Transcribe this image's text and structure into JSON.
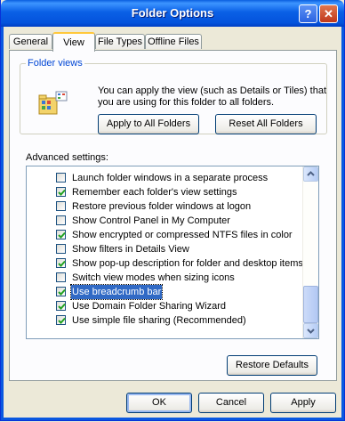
{
  "window": {
    "title": "Folder Options",
    "help_glyph": "?",
    "close_glyph": "✕"
  },
  "tabs": [
    {
      "label": "General",
      "active": false
    },
    {
      "label": "View",
      "active": true
    },
    {
      "label": "File Types",
      "active": false
    },
    {
      "label": "Offline Files",
      "active": false
    }
  ],
  "folder_views": {
    "legend": "Folder views",
    "description": "You can apply the view (such as Details or Tiles) that you are using for this folder to all folders.",
    "apply_button": "Apply to All Folders",
    "reset_button": "Reset All Folders"
  },
  "advanced": {
    "label": "Advanced settings:",
    "items": [
      {
        "label": "Launch folder windows in a separate process",
        "checked": false,
        "selected": false
      },
      {
        "label": "Remember each folder's view settings",
        "checked": true,
        "selected": false
      },
      {
        "label": "Restore previous folder windows at logon",
        "checked": false,
        "selected": false
      },
      {
        "label": "Show Control Panel in My Computer",
        "checked": false,
        "selected": false
      },
      {
        "label": "Show encrypted or compressed NTFS files in color",
        "checked": true,
        "selected": false
      },
      {
        "label": "Show filters in Details View",
        "checked": false,
        "selected": false
      },
      {
        "label": "Show pop-up description for folder and desktop items",
        "checked": true,
        "selected": false
      },
      {
        "label": "Switch view modes when sizing icons",
        "checked": false,
        "selected": false
      },
      {
        "label": "Use breadcrumb bar",
        "checked": true,
        "selected": true
      },
      {
        "label": "Use Domain Folder Sharing Wizard",
        "checked": true,
        "selected": false
      },
      {
        "label": "Use simple file sharing (Recommended)",
        "checked": true,
        "selected": false
      }
    ],
    "restore_defaults": "Restore Defaults"
  },
  "footer": {
    "ok": "OK",
    "cancel": "Cancel",
    "apply": "Apply"
  },
  "colors": {
    "titlebar": "#0453dc",
    "selection": "#316ac5",
    "check": "#21a121"
  }
}
